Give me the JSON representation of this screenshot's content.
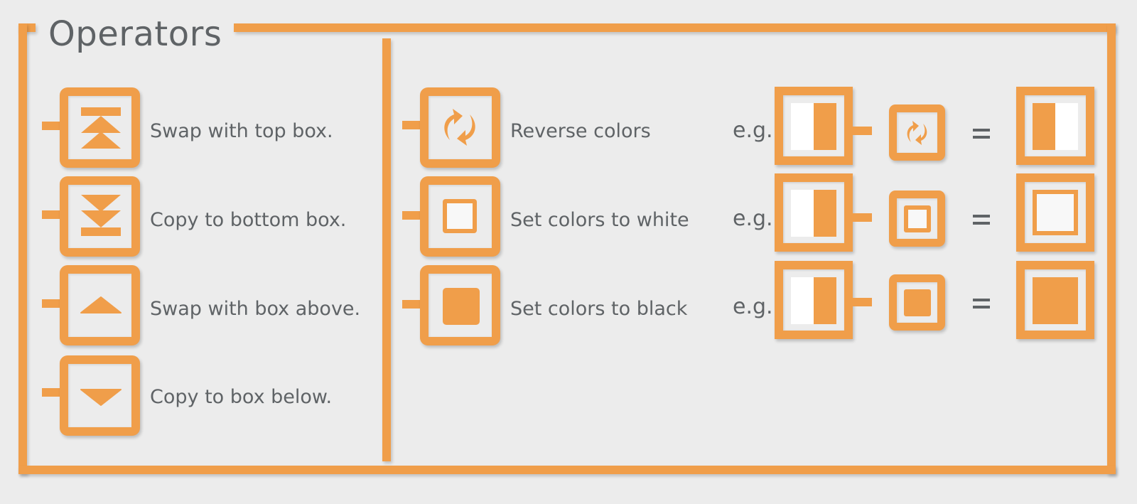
{
  "panel": {
    "title": "Operators",
    "accent_color": "#f09e4a",
    "text_color": "#5f6366"
  },
  "left_operators": [
    {
      "icon": "swap-top-icon",
      "label": "Swap with top box."
    },
    {
      "icon": "copy-bottom-icon",
      "label": "Copy to bottom box."
    },
    {
      "icon": "swap-above-icon",
      "label": "Swap with box above."
    },
    {
      "icon": "copy-below-icon",
      "label": "Copy to box below."
    }
  ],
  "right_operators": [
    {
      "icon": "reverse-colors-icon",
      "label": "Reverse colors",
      "example_prefix": "e.g.",
      "equals": "=",
      "input": "white-left-orange-right",
      "result": "orange-left-white-right"
    },
    {
      "icon": "set-white-icon",
      "label": "Set colors to white",
      "example_prefix": "e.g.",
      "equals": "=",
      "input": "white-left-orange-right",
      "result": "all-white"
    },
    {
      "icon": "set-black-icon",
      "label": "Set colors to black",
      "example_prefix": "e.g.",
      "equals": "=",
      "input": "white-left-orange-right",
      "result": "all-black"
    }
  ]
}
